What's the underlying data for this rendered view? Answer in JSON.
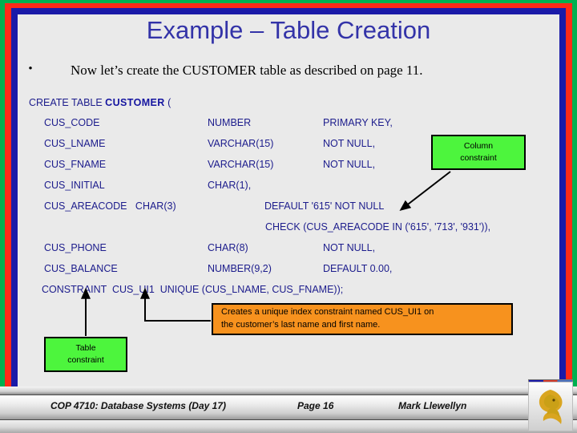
{
  "slide": {
    "title": "Example – Table Creation",
    "bullet_marker": "•",
    "bullet_text": "Now let’s create the CUSTOMER table as described on page 11.",
    "colors": {
      "frame_outer": "#00b050",
      "frame_middle": "#ff2a17",
      "frame_inner": "#1a1aa8",
      "canvas": "#eaeaea",
      "title": "#3333a8",
      "code": "#1c1c8c",
      "callout_green": "#4df53d",
      "callout_orange": "#f7921e"
    }
  },
  "sql": {
    "header_prefix": "CREATE TABLE ",
    "header_table": "CUSTOMER",
    "header_suffix": " (",
    "rows": [
      {
        "name": "CUS_CODE",
        "type": "NUMBER",
        "constraint": "PRIMARY KEY,"
      },
      {
        "name": "CUS_LNAME",
        "type": "VARCHAR(15)",
        "constraint": "NOT NULL,"
      },
      {
        "name": "CUS_FNAME",
        "type": "VARCHAR(15)",
        "constraint": "NOT NULL,"
      },
      {
        "name": "CUS_INITIAL",
        "type": "CHAR(1),",
        "constraint": ""
      }
    ],
    "areacode_line": "CUS_AREACODE   CHAR(3)",
    "areacode_default": "DEFAULT '615' NOT NULL",
    "check_line": "CHECK (CUS_AREACODE IN ('615', '713', '931')),",
    "rows2": [
      {
        "name": "CUS_PHONE",
        "type": "CHAR(8)",
        "constraint": "NOT NULL,"
      },
      {
        "name": "CUS_BALANCE",
        "type": "NUMBER(9,2)",
        "constraint": "DEFAULT 0.00,"
      }
    ],
    "constraint_line": "CONSTRAINT  CUS_UI1  UNIQUE (CUS_LNAME, CUS_FNAME));"
  },
  "callouts": {
    "column_constraint": {
      "line1": "Column",
      "line2": "constraint"
    },
    "table_constraint": {
      "line1": "Table",
      "line2": "constraint"
    },
    "unique_note": {
      "line1": "Creates a unique index constraint named CUS_UI1 on",
      "line2": "the customer’s last name and first name."
    }
  },
  "footer": {
    "course": "COP 4710: Database Systems  (Day 17)",
    "page": "Page 16",
    "author": "Mark Llewellyn",
    "logo_name": "ucf-pegasus-logo"
  }
}
